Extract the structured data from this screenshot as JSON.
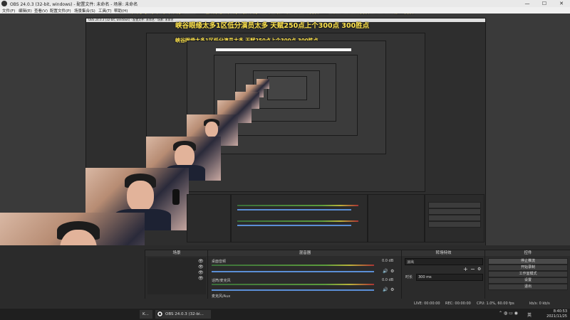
{
  "window": {
    "title": "OBS 24.0.3 (32-bit, windows) - 配置文件: 未命名 - 场景: 未命名",
    "minimize": "—",
    "maximize": "☐",
    "close": "✕"
  },
  "menu": [
    "文件(F)",
    "编辑(E)",
    "查看(V)",
    "配置文件(P)",
    "场景集合(S)",
    "工具(T)",
    "帮助(H)"
  ],
  "banner": "峡谷眼缘太多1区低分演员太多  天赋250点上个300点     300胜点",
  "docks": {
    "scenes": {
      "title": "场景"
    },
    "mixer": {
      "title": "混音器",
      "tracks": [
        {
          "name": "桌面音频",
          "db": "0.0 dB"
        },
        {
          "name": "话筒/麦克风",
          "db": "0.0 dB"
        }
      ],
      "third_track": "麦克风/Aux"
    },
    "transitions": {
      "title": "转场特效",
      "selected": "淡出",
      "duration_label": "时长",
      "duration_value": "300 ms"
    },
    "controls": {
      "title": "控件",
      "buttons": [
        "停止推流",
        "开始录制",
        "工作室模式",
        "设置",
        "退出"
      ]
    }
  },
  "status": {
    "live": "LIVE: 00:00:00",
    "rec": "REC: 00:00:00",
    "cpu": "CPU: 1.0%, 60.00 fps",
    "kbps": "kb/s: 0 kb/s"
  },
  "taskbar": {
    "left_item": "K...",
    "obs_item": "OBS 24.0.3 (32-bi...",
    "time": "8:40:53",
    "date": "2021/11/25",
    "ime": "英"
  },
  "nested_title": "OBS 24.0.3 (32-bit, windows) - 配置文件: 未命名 - 场景: 未命名"
}
